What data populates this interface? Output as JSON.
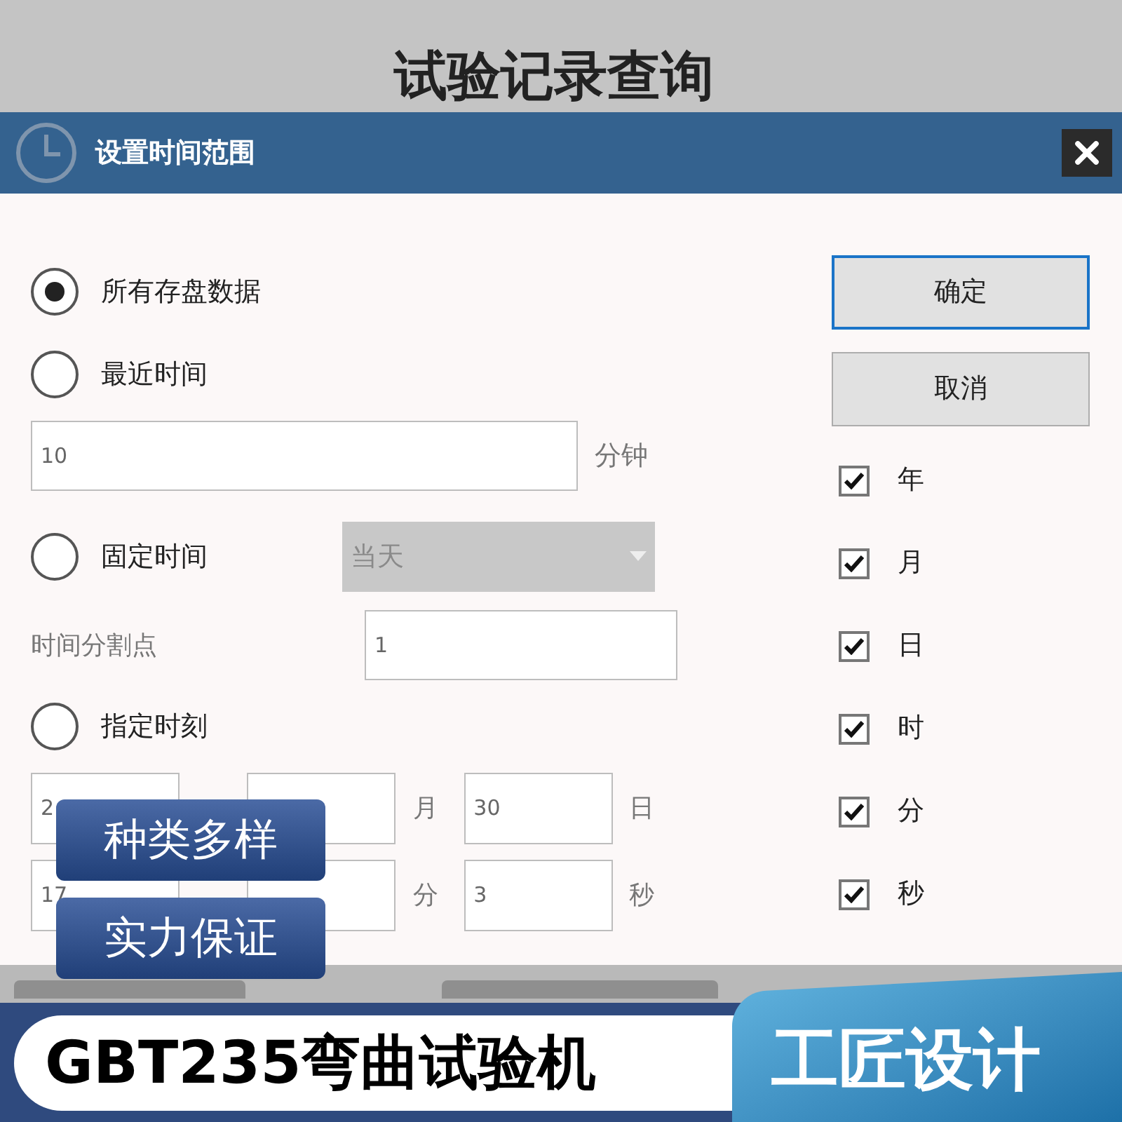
{
  "background_title": "试验记录查询",
  "dialog": {
    "title": "设置时间范围",
    "options": [
      {
        "label": "所有存盘数据",
        "selected": true
      },
      {
        "label": "最近时间",
        "selected": false,
        "field": {
          "value": "10",
          "unit": "分钟"
        }
      },
      {
        "label": "固定时间",
        "selected": false,
        "dropdown": {
          "value": "当天",
          "disabled": true
        },
        "split": {
          "label": "时间分割点",
          "value": "1"
        }
      },
      {
        "label": "指定时刻",
        "selected": false,
        "date": [
          {
            "value": "2"
          },
          {
            "unit": "月"
          },
          {
            "value": "30",
            "unit": "日"
          }
        ],
        "time": [
          {
            "value": "17"
          },
          {
            "unit": "分"
          },
          {
            "value": "3",
            "unit": "秒"
          }
        ]
      }
    ],
    "buttons": [
      {
        "label": "确定",
        "focused": true
      },
      {
        "label": "取消",
        "focused": false
      }
    ],
    "fields": [
      {
        "label": "年",
        "checked": true
      },
      {
        "label": "月",
        "checked": true
      },
      {
        "label": "日",
        "checked": true
      },
      {
        "label": "时",
        "checked": true
      },
      {
        "label": "分",
        "checked": true
      },
      {
        "label": "秒",
        "checked": true
      }
    ]
  },
  "badges": [
    "种类多样",
    "实力保证"
  ],
  "banner": {
    "product": "GBT235弯曲试验机",
    "slogan": "工匠设计"
  }
}
